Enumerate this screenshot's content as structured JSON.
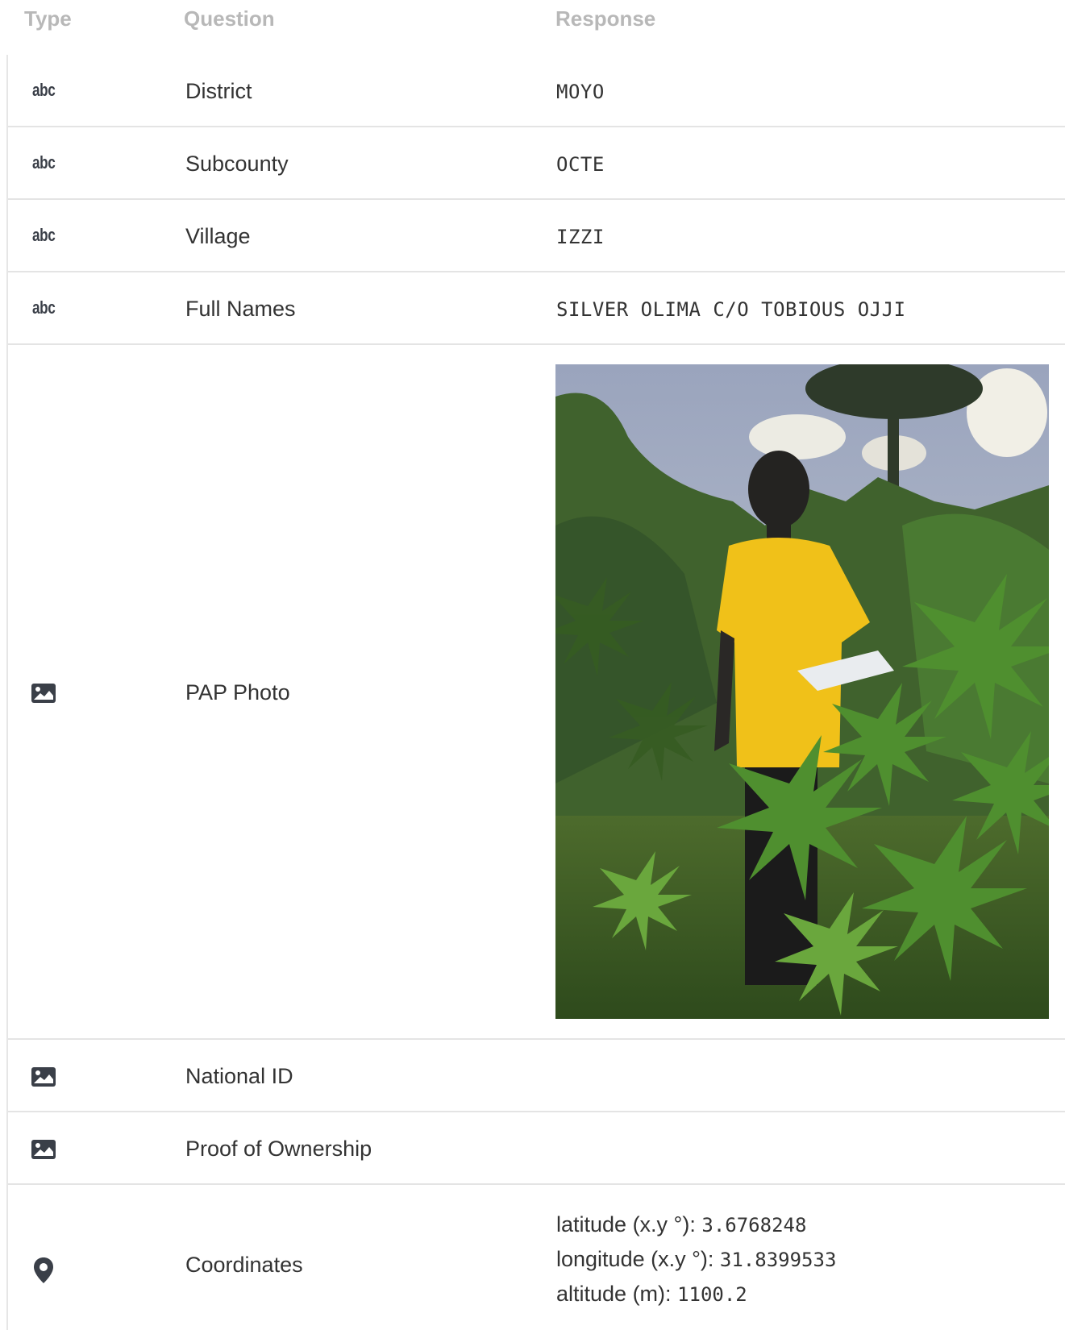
{
  "header": {
    "type_label": "Type",
    "question_label": "Question",
    "response_label": "Response"
  },
  "rows": [
    {
      "type_icon": "abc",
      "question": "District",
      "response": "MOYO"
    },
    {
      "type_icon": "abc",
      "question": "Subcounty",
      "response": "OCTE"
    },
    {
      "type_icon": "abc",
      "question": "Village",
      "response": "IZZI"
    },
    {
      "type_icon": "abc",
      "question": "Full Names",
      "response": "SILVER OLIMA C/O TOBIOUS OJJI"
    },
    {
      "type_icon": "image-icon",
      "question": "PAP Photo",
      "response": "photo"
    },
    {
      "type_icon": "image-icon",
      "question": "National ID",
      "response": ""
    },
    {
      "type_icon": "image-icon",
      "question": "Proof of Ownership",
      "response": ""
    },
    {
      "type_icon": "map-pin-icon",
      "question": "Coordinates",
      "response": "coordinates"
    }
  ],
  "abc_label": "abc",
  "coordinates": {
    "latitude_label": "latitude (x.y °):",
    "latitude_value": "3.6768248",
    "longitude_label": "longitude (x.y °):",
    "longitude_value": "31.8399533",
    "altitude_label": "altitude (m):",
    "altitude_value": "1100.2"
  },
  "colors": {
    "header_text": "#b8b8b8",
    "body_text": "#333333",
    "icon": "#3a3f48",
    "divider": "#e4e4e4",
    "shirt": "#f2c21a",
    "foliage": "#3e7a2c"
  }
}
